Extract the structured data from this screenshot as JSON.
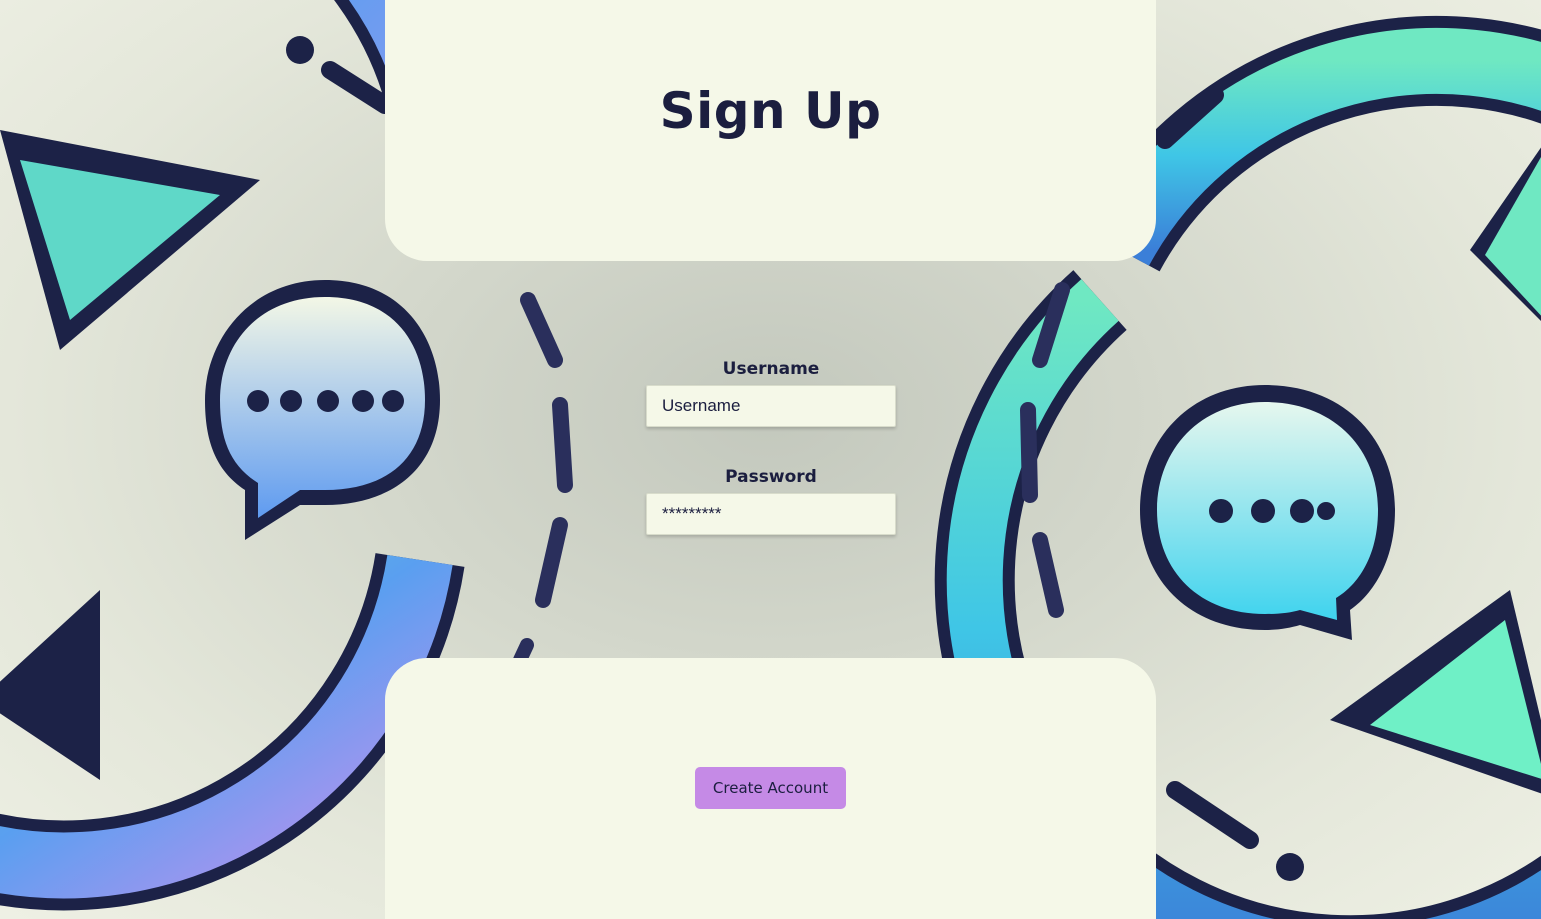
{
  "page": {
    "title": "Sign Up"
  },
  "form": {
    "username": {
      "label": "Username",
      "placeholder": "Username",
      "value": ""
    },
    "password": {
      "label": "Password",
      "value": "*********"
    },
    "submit_label": "Create Account"
  },
  "colors": {
    "panel_bg": "#f5f8e8",
    "text": "#1b1e3f",
    "button_bg": "#c58ae6",
    "accent_teal": "#3fd6c5",
    "accent_blue": "#4a8be8",
    "accent_violet": "#b98aef"
  },
  "icons": {
    "left_graphic": "circular-arrows-chat-bubble-icon",
    "right_graphic": "circular-arrows-chat-bubble-icon"
  }
}
